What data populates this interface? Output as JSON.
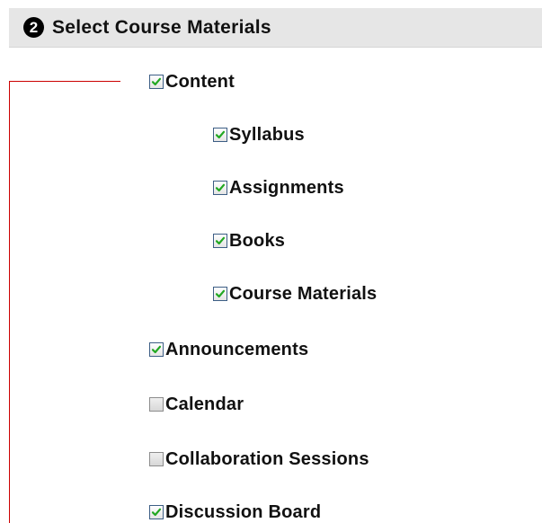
{
  "section": {
    "step_number": "2",
    "title": "Select Course Materials"
  },
  "options": {
    "content": {
      "label": "Content",
      "checked": true
    },
    "syllabus": {
      "label": "Syllabus",
      "checked": true
    },
    "assignments": {
      "label": "Assignments",
      "checked": true
    },
    "books": {
      "label": "Books",
      "checked": true
    },
    "course_materials": {
      "label": "Course Materials",
      "checked": true
    },
    "announcements": {
      "label": "Announcements",
      "checked": true
    },
    "calendar": {
      "label": "Calendar",
      "checked": false
    },
    "collaboration_sessions": {
      "label": "Collaboration Sessions",
      "checked": false
    },
    "discussion_board": {
      "label": "Discussion Board",
      "checked": true
    }
  },
  "colors": {
    "header_bg": "#e6e6e6",
    "bracket": "#cc0000",
    "checkmark": "#22a822",
    "checkbox_border": "#3d5e85"
  },
  "icons": {
    "step_badge": "step-number-badge",
    "checked": "checkmark-icon"
  }
}
